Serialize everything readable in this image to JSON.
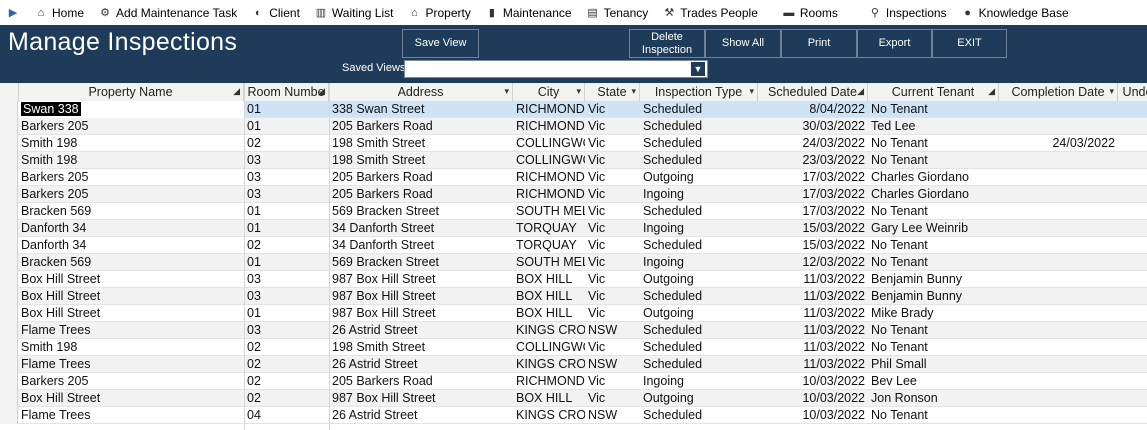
{
  "menu": {
    "items": [
      {
        "name": "home",
        "label": "Home",
        "icon": "⌂"
      },
      {
        "name": "add-maintenance-task",
        "label": "Add Maintenance Task",
        "icon": "⚙"
      },
      {
        "name": "client",
        "label": "Client",
        "icon": "◐"
      },
      {
        "name": "waiting-list",
        "label": "Waiting List",
        "icon": "▥"
      },
      {
        "name": "property",
        "label": "Property",
        "icon": "⌂"
      },
      {
        "name": "maintenance",
        "label": "Maintenance",
        "icon": "▮"
      },
      {
        "name": "tenancy",
        "label": "Tenancy",
        "icon": "▤"
      },
      {
        "name": "trades-people",
        "label": "Trades People",
        "icon": "⚒"
      },
      {
        "name": "rooms",
        "label": "Rooms",
        "icon": "▬"
      },
      {
        "name": "inspections",
        "label": "Inspections",
        "icon": "⚲"
      },
      {
        "name": "knowledge-base",
        "label": "Knowledge Base",
        "icon": "●"
      }
    ]
  },
  "header": {
    "title": "Manage Inspections",
    "save_view": "Save View",
    "delete_inspection": "Delete Inspection",
    "show_all": "Show All",
    "print": "Print",
    "export": "Export",
    "exit": "EXIT",
    "saved_views_label": "Saved Views:",
    "saved_views_value": ""
  },
  "grid": {
    "columns": [
      {
        "label": "Property Name",
        "sort": "◢"
      },
      {
        "label": "Room Numbe",
        "sort": "◢"
      },
      {
        "label": "Address",
        "sort": "▾"
      },
      {
        "label": "City",
        "sort": "▾"
      },
      {
        "label": "State",
        "sort": "▾"
      },
      {
        "label": "Inspection Type",
        "sort": "▾"
      },
      {
        "label": "Scheduled Date",
        "sort": "◢"
      },
      {
        "label": "Current Tenant",
        "sort": "◢"
      },
      {
        "label": "Completion Date",
        "sort": "▾"
      },
      {
        "label": "Unde",
        "sort": ""
      }
    ],
    "rows": [
      [
        "Swan 338",
        "01",
        "338 Swan Street",
        "RICHMOND",
        "Vic",
        "Scheduled",
        "8/04/2022",
        "No Tenant",
        ""
      ],
      [
        "Barkers 205",
        "01",
        "205 Barkers Road",
        "RICHMOND",
        "Vic",
        "Scheduled",
        "30/03/2022",
        "Ted Lee",
        ""
      ],
      [
        "Smith 198",
        "02",
        "198 Smith Street",
        "COLLINGWOOD",
        "Vic",
        "Scheduled",
        "24/03/2022",
        "No Tenant",
        "24/03/2022"
      ],
      [
        "Smith 198",
        "03",
        "198 Smith Street",
        "COLLINGWOOD",
        "Vic",
        "Scheduled",
        "23/03/2022",
        "No Tenant",
        ""
      ],
      [
        "Barkers 205",
        "03",
        "205 Barkers Road",
        "RICHMOND",
        "Vic",
        "Outgoing",
        "17/03/2022",
        "Charles Giordano",
        ""
      ],
      [
        "Barkers 205",
        "03",
        "205 Barkers Road",
        "RICHMOND",
        "Vic",
        "Ingoing",
        "17/03/2022",
        "Charles Giordano",
        ""
      ],
      [
        "Bracken 569",
        "01",
        "569 Bracken Street",
        "SOUTH MELBOURNE",
        "Vic",
        "Scheduled",
        "17/03/2022",
        "No Tenant",
        ""
      ],
      [
        "Danforth 34",
        "01",
        "34 Danforth Street",
        "TORQUAY",
        "Vic",
        "Ingoing",
        "15/03/2022",
        "Gary Lee Weinrib",
        ""
      ],
      [
        "Danforth 34",
        "02",
        "34 Danforth Street",
        "TORQUAY",
        "Vic",
        "Scheduled",
        "15/03/2022",
        "No Tenant",
        ""
      ],
      [
        "Bracken 569",
        "01",
        "569 Bracken Street",
        "SOUTH MELBOURNE",
        "Vic",
        "Ingoing",
        "12/03/2022",
        "No Tenant",
        ""
      ],
      [
        "Box Hill Street",
        "03",
        "987 Box Hill Street",
        "BOX HILL",
        "Vic",
        "Outgoing",
        "11/03/2022",
        "Benjamin Bunny",
        ""
      ],
      [
        "Box Hill Street",
        "03",
        "987 Box Hill Street",
        "BOX HILL",
        "Vic",
        "Scheduled",
        "11/03/2022",
        "Benjamin Bunny",
        ""
      ],
      [
        "Box Hill Street",
        "01",
        "987 Box Hill Street",
        "BOX HILL",
        "Vic",
        "Outgoing",
        "11/03/2022",
        "Mike Brady",
        ""
      ],
      [
        "Flame Trees",
        "03",
        "26 Astrid Street",
        "KINGS CROSS",
        "NSW",
        "Scheduled",
        "11/03/2022",
        "No Tenant",
        ""
      ],
      [
        "Smith 198",
        "02",
        "198 Smith Street",
        "COLLINGWOOD",
        "Vic",
        "Scheduled",
        "11/03/2022",
        "No Tenant",
        ""
      ],
      [
        "Flame Trees",
        "02",
        "26 Astrid Street",
        "KINGS CROSS",
        "NSW",
        "Scheduled",
        "11/03/2022",
        "Phil Small",
        ""
      ],
      [
        "Barkers 205",
        "02",
        "205 Barkers Road",
        "RICHMOND",
        "Vic",
        "Ingoing",
        "10/03/2022",
        "Bev Lee",
        ""
      ],
      [
        "Box Hill Street",
        "02",
        "987 Box Hill Street",
        "BOX HILL",
        "Vic",
        "Outgoing",
        "10/03/2022",
        "Jon Ronson",
        ""
      ],
      [
        "Flame Trees",
        "04",
        "26 Astrid Street",
        "KINGS CROSS",
        "NSW",
        "Scheduled",
        "10/03/2022",
        "No Tenant",
        ""
      ]
    ]
  },
  "colors": {
    "header_bg": "#1e3c5a",
    "selected_row": "#cfe3f7",
    "alt_row": "#f2f2f2"
  }
}
